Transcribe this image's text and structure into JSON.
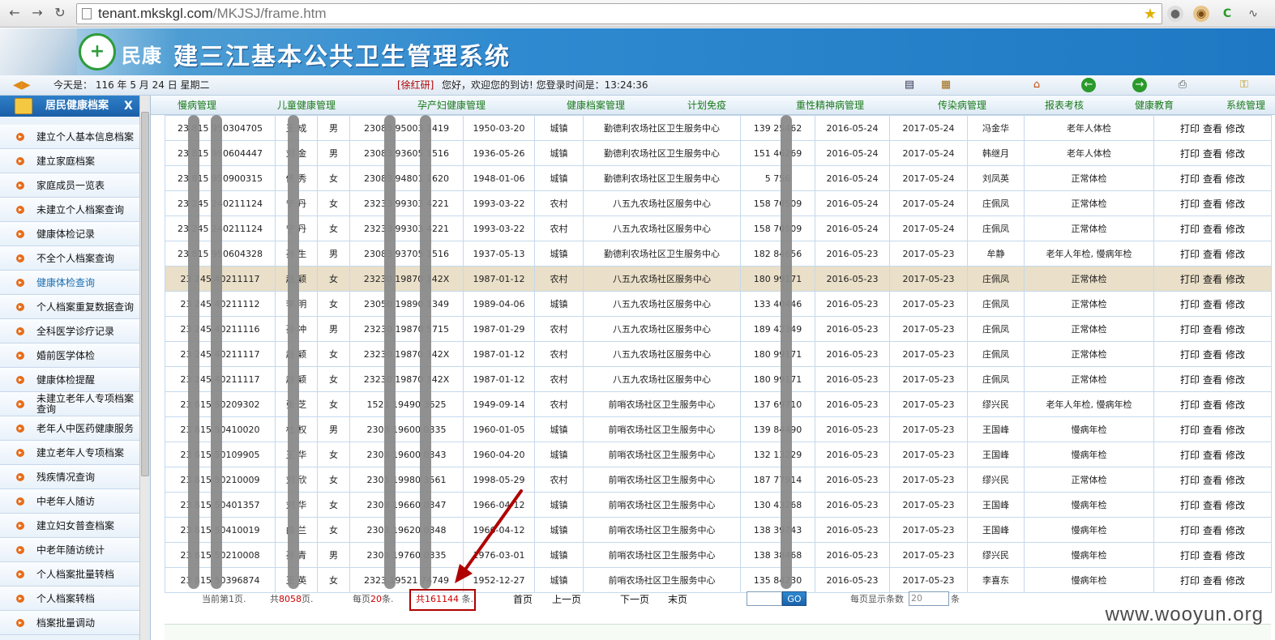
{
  "browser": {
    "url_host": "tenant.mkskgl.com",
    "url_path": "/MKJSJ/frame.htm"
  },
  "header": {
    "brand": "民康",
    "system_title": "建三江基本公共卫生管理系统"
  },
  "infobar": {
    "today": "今天是：  116 年 5 月 24 日    星期二",
    "user": "[徐红研]",
    "welcome": "您好，欢迎您的到访! 您登录时间是：13:24:36"
  },
  "sidebar": {
    "title": "居民健康档案",
    "items": [
      "建立个人基本信息档案",
      "建立家庭档案",
      "家庭成员一览表",
      "未建立个人档案查询",
      "健康体检记录",
      "不全个人档案查询",
      "健康体检查询",
      "个人档案重复数据查询",
      "全科医学诊疗记录",
      "婚前医学体检",
      "健康体检提醒",
      "未建立老年人专项档案查询",
      "老年人中医药健康服务",
      "建立老年人专项档案",
      "残疾情况查询",
      "中老年人随访",
      "建立妇女普查档案",
      "中老年随访统计",
      "个人档案批量转档",
      "个人档案转档",
      "档案批量调动"
    ]
  },
  "modules": [
    "慢病管理",
    "儿童健康管理",
    "孕产妇健康管理",
    "健康档案管理",
    "计划免疫",
    "重性精神病管理",
    "传染病管理",
    "报表考核",
    "健康教育",
    "系统管理"
  ],
  "table": {
    "actions": [
      "打印",
      "查看",
      "修改"
    ],
    "rows": [
      [
        "23  815  950304705",
        "王  成",
        "男",
        "23083  95003  1419",
        "1950-03-20",
        "城镇",
        "勤德利农场社区卫生服务中心",
        "139  25462",
        "2016-05-24",
        "2017-05-24",
        "冯金华",
        "老年人体检"
      ],
      [
        "23  815  950604447",
        "刘  金",
        "男",
        "23083  93605  1516",
        "1936-05-26",
        "城镇",
        "勤德利农场社区卫生服务中心",
        "151  46269",
        "2016-05-24",
        "2017-05-24",
        "韩继月",
        "老年人体检"
      ],
      [
        "23  815  950900315",
        "佟  秀",
        "女",
        "23083  94801  1620",
        "1948-01-06",
        "城镇",
        "勤德利农场社区卫生服务中心",
        "5  756",
        "2016-05-24",
        "2017-05-24",
        "刘凤英",
        "正常体检"
      ],
      [
        "23  245  240211124",
        "宁  丹",
        "女",
        "23233  99303  4221",
        "1993-03-22",
        "农村",
        "八五九农场社区服务中心",
        "158  70509",
        "2016-05-24",
        "2017-05-24",
        "庄佩凤",
        "正常体检"
      ],
      [
        "23  245  240211124",
        "宁  丹",
        "女",
        "23233  99303  4221",
        "1993-03-22",
        "农村",
        "八五九农场社区服务中心",
        "158  70509",
        "2016-05-24",
        "2017-05-24",
        "庄佩凤",
        "正常体检"
      ],
      [
        "23  815  950604328",
        "孙  生",
        "男",
        "23083  93705  1516",
        "1937-05-13",
        "城镇",
        "勤德利农场社区卫生服务中心",
        "182  84656",
        "2016-05-23",
        "2017-05-23",
        "牟静",
        "老年人年检, 慢病年检"
      ],
      [
        "23  245  40211117",
        "赵  颖",
        "女",
        "23230  19870  342X",
        "1987-01-12",
        "农村",
        "八五九农场社区服务中心",
        "180  99171",
        "2016-05-23",
        "2017-05-23",
        "庄佩凤",
        "正常体检"
      ],
      [
        "23  245  40211112",
        "李  明",
        "女",
        "23050  19890  1349",
        "1989-04-06",
        "城镇",
        "八五九农场社区服务中心",
        "133  40446",
        "2016-05-23",
        "2017-05-23",
        "庄佩凤",
        "正常体检"
      ],
      [
        "23  245  40211116",
        "孙  冲",
        "男",
        "23230  19870  5715",
        "1987-01-29",
        "农村",
        "八五九农场社区服务中心",
        "189  42349",
        "2016-05-23",
        "2017-05-23",
        "庄佩凤",
        "正常体检"
      ],
      [
        "23  245  40211117",
        "赵  颖",
        "女",
        "23230  19870  342X",
        "1987-01-12",
        "农村",
        "八五九农场社区服务中心",
        "180  99171",
        "2016-05-23",
        "2017-05-23",
        "庄佩凤",
        "正常体检"
      ],
      [
        "23  245  40211117",
        "赵  颖",
        "女",
        "23230  19870  342X",
        "1987-01-12",
        "农村",
        "八五九农场社区服务中心",
        "180  99171",
        "2016-05-23",
        "2017-05-23",
        "庄佩凤",
        "正常体检"
      ],
      [
        "23  815  50209302",
        "张  芝",
        "女",
        "1521  19490  3625",
        "1949-09-14",
        "农村",
        "前哨农场社区卫生服务中心",
        "137  69710",
        "2016-05-23",
        "2017-05-23",
        "缪兴民",
        "老年人年检, 慢病年检"
      ],
      [
        "23  815  50410020",
        "杜  权",
        "男",
        "2308  19600  0335",
        "1960-01-05",
        "城镇",
        "前哨农场社区卫生服务中心",
        "139  84490",
        "2016-05-23",
        "2017-05-23",
        "王国峰",
        "慢病年检"
      ],
      [
        "23  815  50109905",
        "王  华",
        "女",
        "2308  19600  0343",
        "1960-04-20",
        "城镇",
        "前哨农场社区卫生服务中心",
        "132  13229",
        "2016-05-23",
        "2017-05-23",
        "王国峰",
        "慢病年检"
      ],
      [
        "23  815  50210009",
        "刘  欣",
        "女",
        "2301  19980  3561",
        "1998-05-29",
        "农村",
        "前哨农场社区卫生服务中心",
        "187  77914",
        "2016-05-23",
        "2017-05-23",
        "缪兴民",
        "正常体检"
      ],
      [
        "23  815  50401357",
        "刘  华",
        "女",
        "2308  19660  0347",
        "1966-04-12",
        "城镇",
        "前哨农场社区卫生服务中心",
        "130  43268",
        "2016-05-23",
        "2017-05-23",
        "王国峰",
        "慢病年检"
      ],
      [
        "23  815  50410019",
        "曲  兰",
        "女",
        "2308  19620  0348",
        "1966-04-12",
        "城镇",
        "前哨农场社区卫生服务中心",
        "138  39743",
        "2016-05-23",
        "2017-05-23",
        "王国峰",
        "慢病年检"
      ],
      [
        "23  815  50210008",
        "孙  青",
        "男",
        "2308  19760  0335",
        "1976-03-01",
        "城镇",
        "前哨农场社区卫生服务中心",
        "138  38468",
        "2016-05-23",
        "2017-05-23",
        "缪兴民",
        "慢病年检"
      ],
      [
        "23  815  50396874",
        "王  英",
        "女",
        "2323  19521  74749",
        "1952-12-27",
        "城镇",
        "前哨农场社区卫生服务中心",
        "135  84230",
        "2016-05-23",
        "2017-05-23",
        "李喜东",
        "慢病年检"
      ]
    ]
  },
  "pager": {
    "current_prefix": "当前第",
    "current_page": "1",
    "current_suffix": "页.",
    "total_prefix": "共",
    "total_pages": "8058",
    "total_pages_suffix": "页.",
    "per_page_prefix": "每页",
    "per_page": "20",
    "per_page_suffix": "条.",
    "total_records_prefix": "共",
    "total_records": "161144",
    "total_records_suffix": "条.",
    "first": "首页",
    "prev": "上一页",
    "next": "下一页",
    "last": "末页",
    "go": "GO",
    "page_size_label": "每页显示条数",
    "page_size_value": "20",
    "page_size_unit": "条"
  },
  "watermark": "www.wooyun.org",
  "colors": {
    "banner": "#1f78c3",
    "highlight_row": "#eadfc8",
    "annotation": "#b00000",
    "module_text": "#1a7a1a"
  }
}
